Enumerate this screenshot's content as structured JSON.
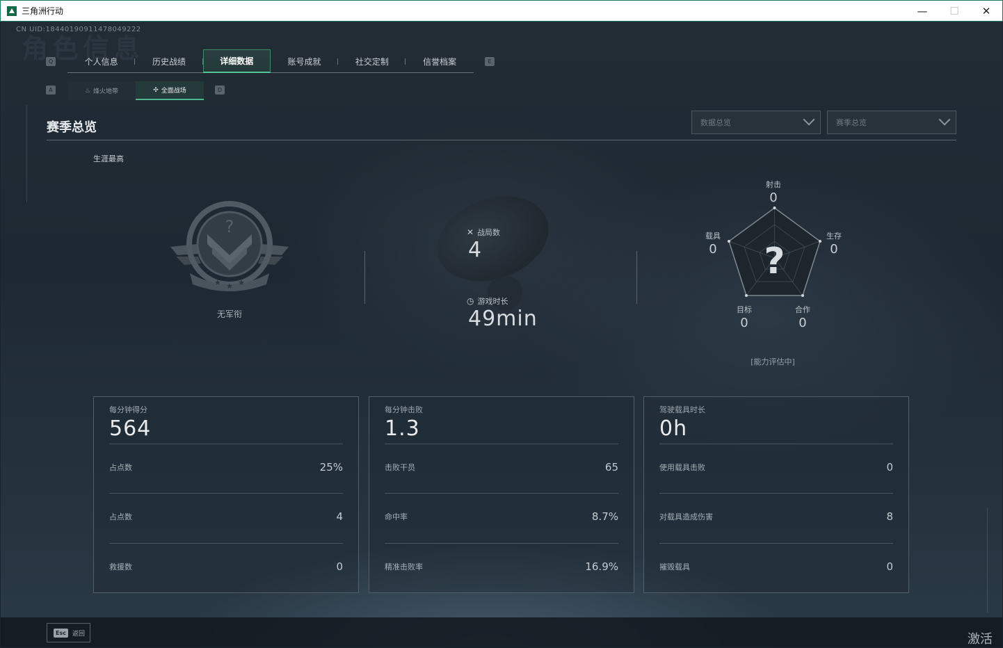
{
  "window": {
    "title": "三角洲行动",
    "minimize": "—",
    "maximize": "☐",
    "close": "✕"
  },
  "uid": "CN UID:18440190911478049222",
  "ghost_title": "角色信息",
  "tabs": {
    "left_key": "Q",
    "right_key": "E",
    "items": [
      {
        "label": "个人信息",
        "active": false
      },
      {
        "label": "历史战绩",
        "active": false
      },
      {
        "label": "详细数据",
        "active": true
      },
      {
        "label": "账号成就",
        "active": false
      },
      {
        "label": "社交定制",
        "active": false
      },
      {
        "label": "信誉档案",
        "active": false
      }
    ]
  },
  "subtabs": {
    "left_key": "A",
    "right_key": "D",
    "items": [
      {
        "label": "烽火地带",
        "icon": "flame-icon",
        "glyph": "♨",
        "active": false
      },
      {
        "label": "全面战场",
        "icon": "crosshair-icon",
        "glyph": "✣",
        "active": true
      }
    ]
  },
  "section": {
    "title": "赛季总览",
    "dropdowns": [
      {
        "value": "数据总览"
      },
      {
        "value": "赛季总览"
      }
    ]
  },
  "career": {
    "label": "生涯最高",
    "rank_name": "无军衔"
  },
  "summary": {
    "matches_label": "战局数",
    "matches_value": "4",
    "playtime_label": "游戏时长",
    "playtime_value": "49min"
  },
  "radar": {
    "center_glyph": "?",
    "axes": [
      {
        "label": "射击",
        "value": "0"
      },
      {
        "label": "生存",
        "value": "0"
      },
      {
        "label": "合作",
        "value": "0"
      },
      {
        "label": "目标",
        "value": "0"
      },
      {
        "label": "载具",
        "value": "0"
      }
    ],
    "note": "[能力评估中]"
  },
  "cards": [
    {
      "title": "每分钟得分",
      "value": "564",
      "rows": [
        {
          "label": "占点数",
          "value": "25%"
        },
        {
          "label": "占点数",
          "value": "4"
        },
        {
          "label": "救援数",
          "value": "0"
        }
      ]
    },
    {
      "title": "每分钟击败",
      "value": "1.3",
      "rows": [
        {
          "label": "击败干员",
          "value": "65"
        },
        {
          "label": "命中率",
          "value": "8.7%"
        },
        {
          "label": "精准击败率",
          "value": "16.9%"
        }
      ]
    },
    {
      "title": "驾驶载具时长",
      "value": "0h",
      "rows": [
        {
          "label": "使用载具击败",
          "value": "0"
        },
        {
          "label": "对载具造成伤害",
          "value": "8"
        },
        {
          "label": "摧毁载具",
          "value": "0"
        }
      ]
    }
  ],
  "footer": {
    "esc_key": "Esc",
    "esc_label": "返回",
    "watermark": "激活 W"
  },
  "colors": {
    "accent": "#4fb890",
    "titlebar_border": "#1e7a5a"
  }
}
